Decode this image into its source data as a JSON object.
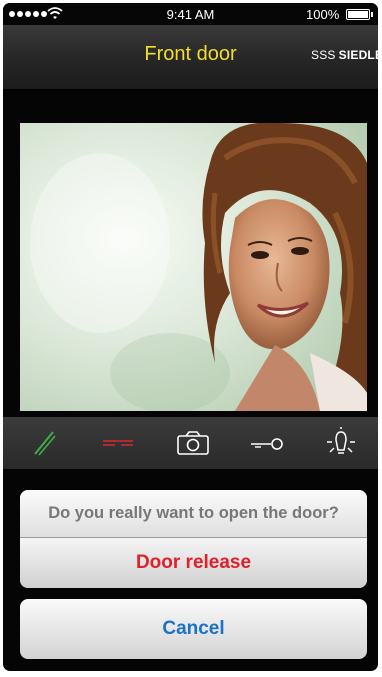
{
  "status_bar": {
    "time": "9:41 AM",
    "battery_percent": "100%",
    "signal_bars": 5,
    "icons": [
      "signal-dots-icon",
      "wifi-icon",
      "battery-icon"
    ]
  },
  "nav": {
    "title": "Front door",
    "brand_mark": "SSS",
    "brand_name": "SIEDLE",
    "title_color": "#f2dd2a"
  },
  "toolbar": {
    "items": [
      {
        "name": "answer-call-icon",
        "color": "#3fae49"
      },
      {
        "name": "end-call-icon",
        "color": "#d82a2a"
      },
      {
        "name": "camera-icon",
        "color": "#ffffff"
      },
      {
        "name": "door-key-icon",
        "color": "#ffffff"
      },
      {
        "name": "light-icon",
        "color": "#ffffff"
      }
    ]
  },
  "dialog": {
    "message": "Do you really want to open the door?",
    "action_label": "Door release",
    "cancel_label": "Cancel",
    "action_color": "#e0202a",
    "cancel_color": "#1a72c9"
  }
}
